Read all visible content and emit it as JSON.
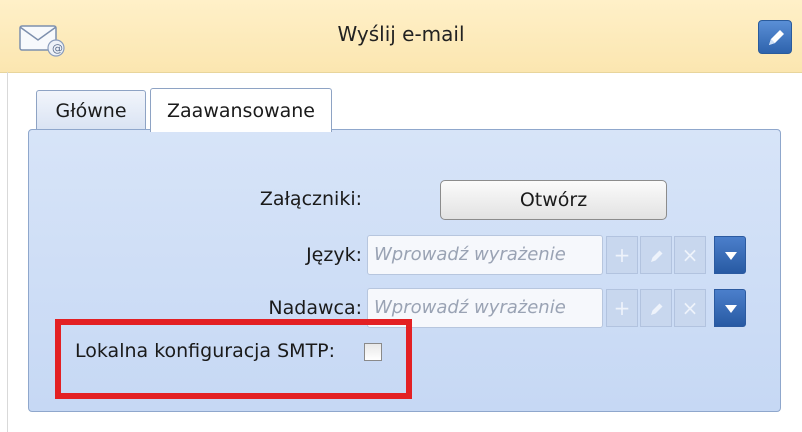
{
  "header": {
    "title": "Wyślij e-mail",
    "icon": "envelope-icon",
    "edit_icon": "pencil-icon",
    "background_color": "#fbe6b0"
  },
  "tabs": [
    {
      "label": "Główne",
      "active": false
    },
    {
      "label": "Zaawansowane",
      "active": true
    }
  ],
  "form": {
    "attachments_label": "Załączniki:",
    "open_button_label": "Otwórz",
    "language_label": "Język:",
    "language_placeholder": "Wprowadź wyrażenie",
    "sender_label": "Nadawca:",
    "sender_placeholder": "Wprowadź wyrażenie",
    "smtp_label": "Lokalna konfiguracja SMTP:",
    "smtp_checked": false,
    "add_symbol": "+",
    "clear_symbol": "×"
  },
  "highlight_color": "#e32023"
}
